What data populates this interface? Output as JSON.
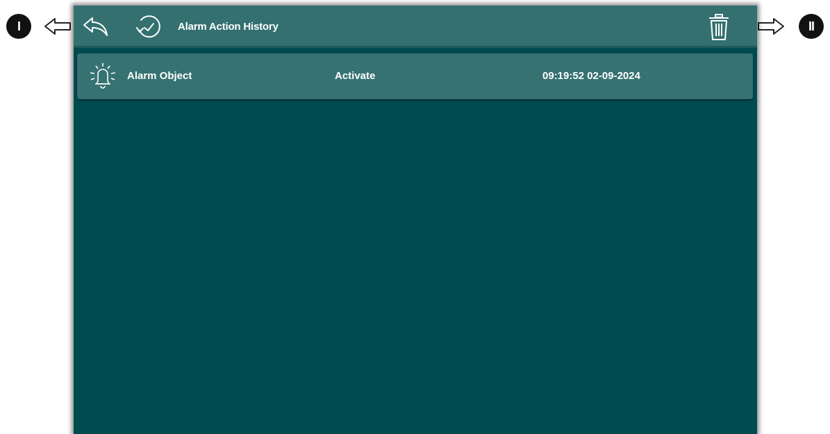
{
  "callouts": {
    "left": "I",
    "right": "II"
  },
  "header": {
    "title": "Alarm Action History",
    "icons": {
      "back": "back-arrow-icon",
      "history": "history-clock-icon",
      "delete": "trash-icon"
    }
  },
  "history": {
    "rows": [
      {
        "icon": "alarm-bell-icon",
        "object": "Alarm Object",
        "action": "Activate",
        "timestamp": "09:19:52 02-09-2024"
      }
    ]
  },
  "colors": {
    "background": "#004b50",
    "topbar": "#347070",
    "row": "#367272",
    "text": "#ffffff"
  }
}
